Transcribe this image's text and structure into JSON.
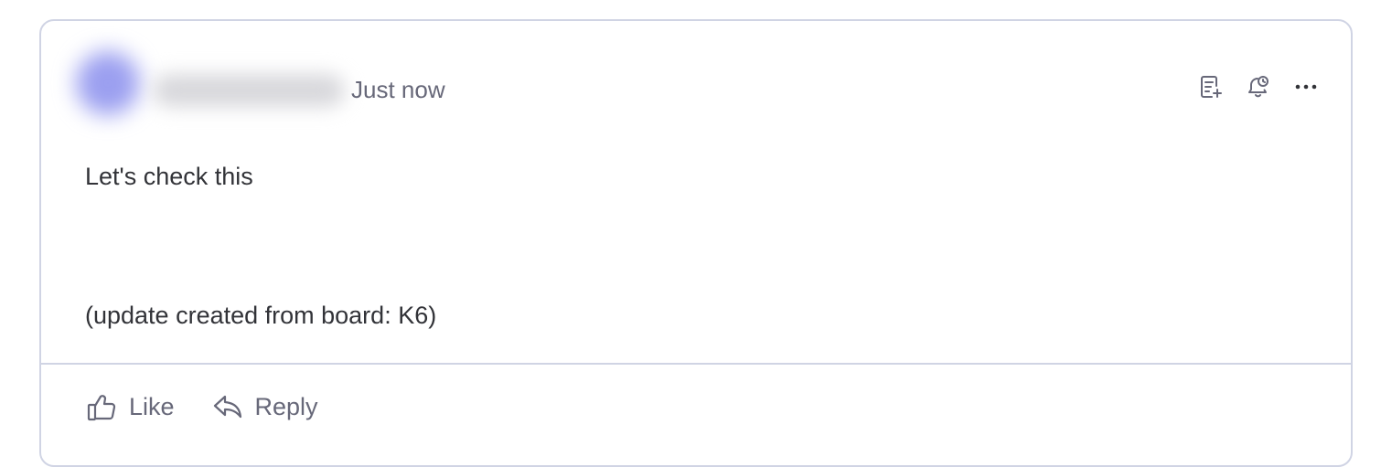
{
  "update": {
    "timestamp": "Just now",
    "body_lines": [
      "Let's check this",
      "(update created from board: K6)"
    ],
    "header_icons": [
      "add-to-tasks-icon",
      "reminder-icon",
      "more-options-icon"
    ]
  },
  "actions": {
    "like_label": "Like",
    "reply_label": "Reply"
  },
  "colors": {
    "border": "#d0d4e4",
    "text_primary": "#323338",
    "text_secondary": "#676879",
    "avatar": "#9b9ff0"
  }
}
